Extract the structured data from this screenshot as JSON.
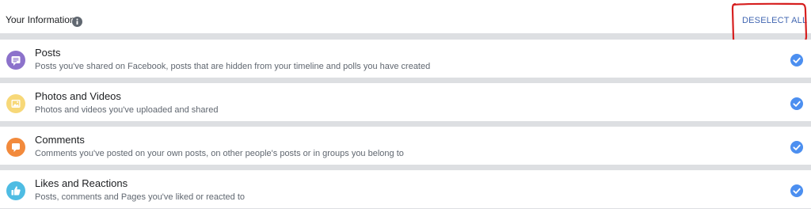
{
  "header": {
    "title": "Your Information",
    "info_icon": "info-icon",
    "deselect_label": "DESELECT ALL",
    "accent_color": "#4267b2"
  },
  "categories": [
    {
      "title": "Posts",
      "description": "Posts you've shared on Facebook, posts that are hidden from your timeline and polls you have created",
      "icon": "posts-icon",
      "icon_color": "#8c72cb",
      "selected": true
    },
    {
      "title": "Photos and Videos",
      "description": "Photos and videos you've uploaded and shared",
      "icon": "photo-icon",
      "icon_color": "#f7d878",
      "selected": true
    },
    {
      "title": "Comments",
      "description": "Comments you've posted on your own posts, on other people's posts or in groups you belong to",
      "icon": "comment-icon",
      "icon_color": "#f28a3c",
      "selected": true
    },
    {
      "title": "Likes and Reactions",
      "description": "Posts, comments and Pages you've liked or reacted to",
      "icon": "thumbs-up-icon",
      "icon_color": "#4ebce3",
      "selected": true
    }
  ],
  "check_color": "#4c8ff0"
}
